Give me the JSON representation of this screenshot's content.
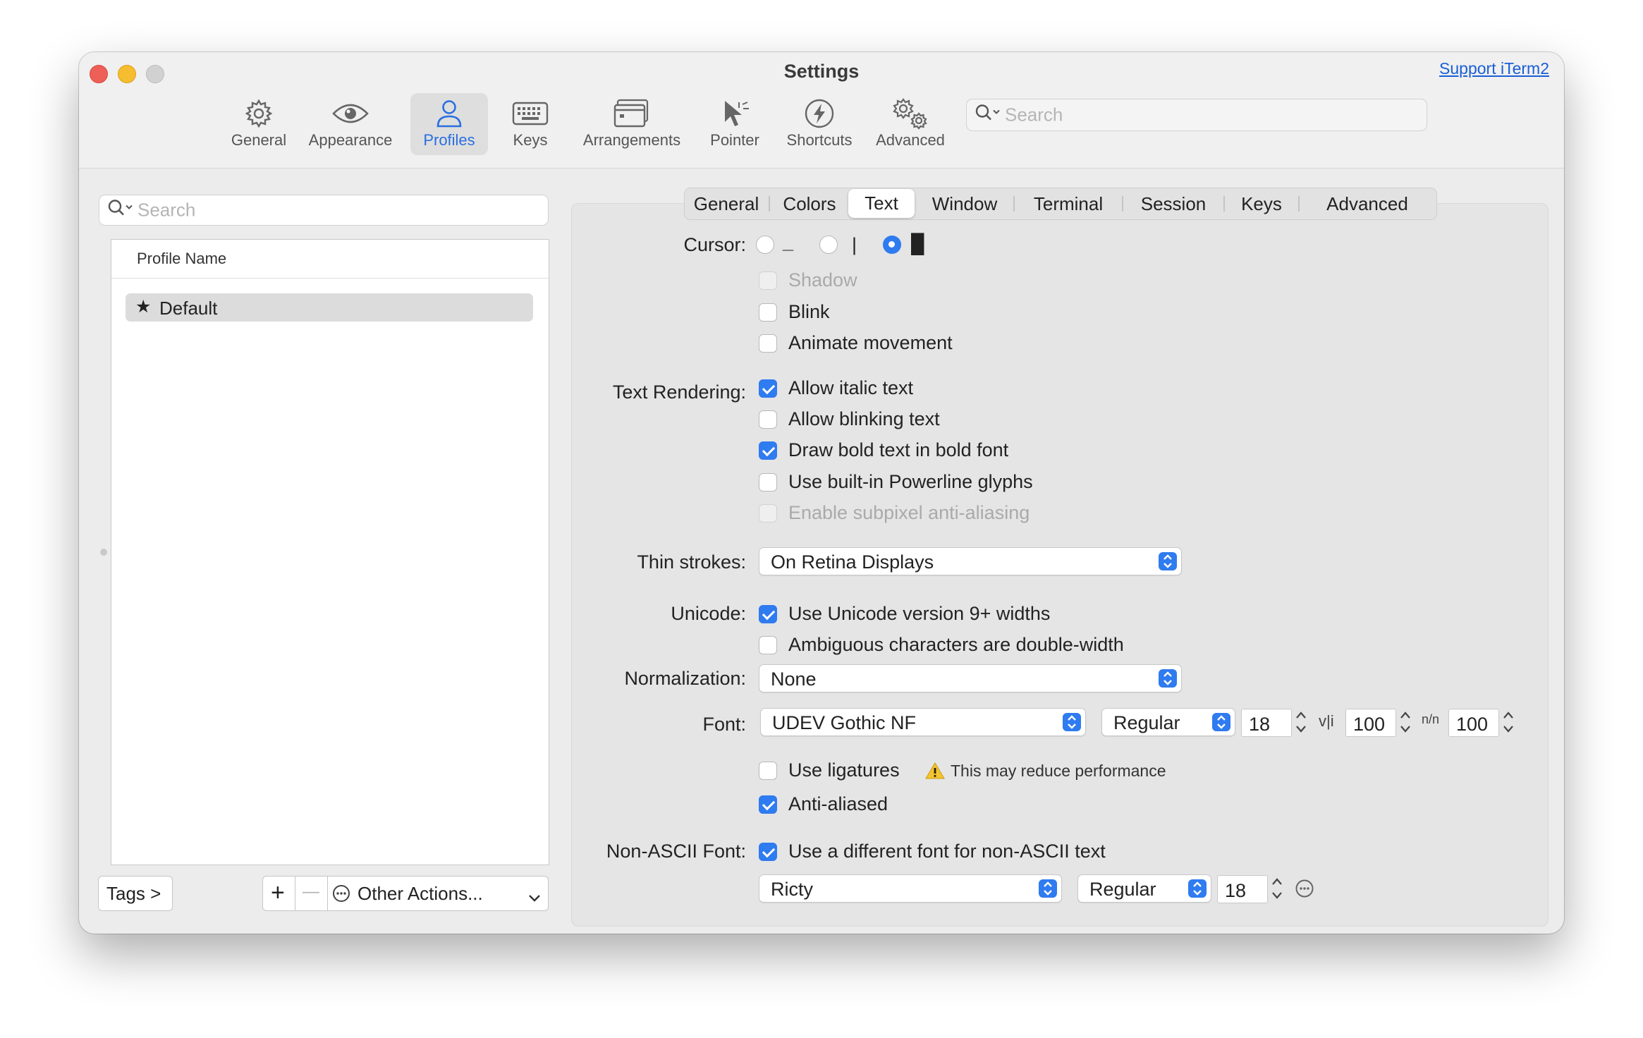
{
  "window": {
    "title": "Settings",
    "support_link": "Support iTerm2",
    "colors": {
      "close": "#ee5f57",
      "minimize": "#f5bd2f",
      "zoom": "#cfcfcf",
      "accent": "#2f7bf0"
    }
  },
  "toolbar": {
    "items": [
      {
        "label": "General",
        "icon": "gear-icon"
      },
      {
        "label": "Appearance",
        "icon": "eye-icon"
      },
      {
        "label": "Profiles",
        "icon": "person-icon",
        "selected": true
      },
      {
        "label": "Keys",
        "icon": "keyboard-icon"
      },
      {
        "label": "Arrangements",
        "icon": "windows-icon"
      },
      {
        "label": "Pointer",
        "icon": "pointer-icon"
      },
      {
        "label": "Shortcuts",
        "icon": "bolt-icon"
      },
      {
        "label": "Advanced",
        "icon": "gears-icon"
      }
    ],
    "search_placeholder": "Search"
  },
  "profiles": {
    "search_placeholder": "Search",
    "column_header": "Profile Name",
    "items": [
      {
        "name": "Default",
        "star": "★",
        "selected": true
      }
    ],
    "tags_button": "Tags >",
    "add_symbol": "+",
    "remove_symbol": "—",
    "other_actions": "Other Actions..."
  },
  "tabs": {
    "items": [
      "General",
      "Colors",
      "Text",
      "Window",
      "Terminal",
      "Session",
      "Keys",
      "Advanced"
    ],
    "active": "Text"
  },
  "text_settings": {
    "cursor": {
      "label": "Cursor:",
      "options": [
        {
          "glyph": "_",
          "selected": false
        },
        {
          "glyph": "|",
          "selected": false
        },
        {
          "glyph": "█",
          "selected": true
        }
      ],
      "checkboxes": [
        {
          "label": "Shadow",
          "checked": false,
          "disabled": true
        },
        {
          "label": "Blink",
          "checked": false,
          "disabled": false
        },
        {
          "label": "Animate movement",
          "checked": false,
          "disabled": false
        }
      ]
    },
    "text_rendering": {
      "label": "Text Rendering:",
      "checkboxes": [
        {
          "label": "Allow italic text",
          "checked": true,
          "disabled": false
        },
        {
          "label": "Allow blinking text",
          "checked": false,
          "disabled": false
        },
        {
          "label": "Draw bold text in bold font",
          "checked": true,
          "disabled": false
        },
        {
          "label": "Use built-in Powerline glyphs",
          "checked": false,
          "disabled": false
        },
        {
          "label": "Enable subpixel anti-aliasing",
          "checked": false,
          "disabled": true
        }
      ]
    },
    "thin_strokes": {
      "label": "Thin strokes:",
      "value": "On Retina Displays"
    },
    "unicode": {
      "label": "Unicode:",
      "checkboxes": [
        {
          "label": "Use Unicode version 9+ widths",
          "checked": true
        },
        {
          "label": "Ambiguous characters are double-width",
          "checked": false
        }
      ]
    },
    "normalization": {
      "label": "Normalization:",
      "value": "None"
    },
    "font": {
      "label": "Font:",
      "family": "UDEV Gothic NF",
      "weight": "Regular",
      "size": "18",
      "h_spacing_icon": "v|i",
      "h_spacing": "100",
      "v_spacing_icon": "n/n",
      "v_spacing": "100",
      "ligatures": {
        "label": "Use ligatures",
        "checked": false
      },
      "warning": "This may reduce performance",
      "anti_aliased": {
        "label": "Anti-aliased",
        "checked": true
      }
    },
    "non_ascii": {
      "label": "Non-ASCII Font:",
      "use_different": {
        "label": "Use a different font for non-ASCII text",
        "checked": true
      },
      "family": "Ricty",
      "weight": "Regular",
      "size": "18"
    }
  }
}
